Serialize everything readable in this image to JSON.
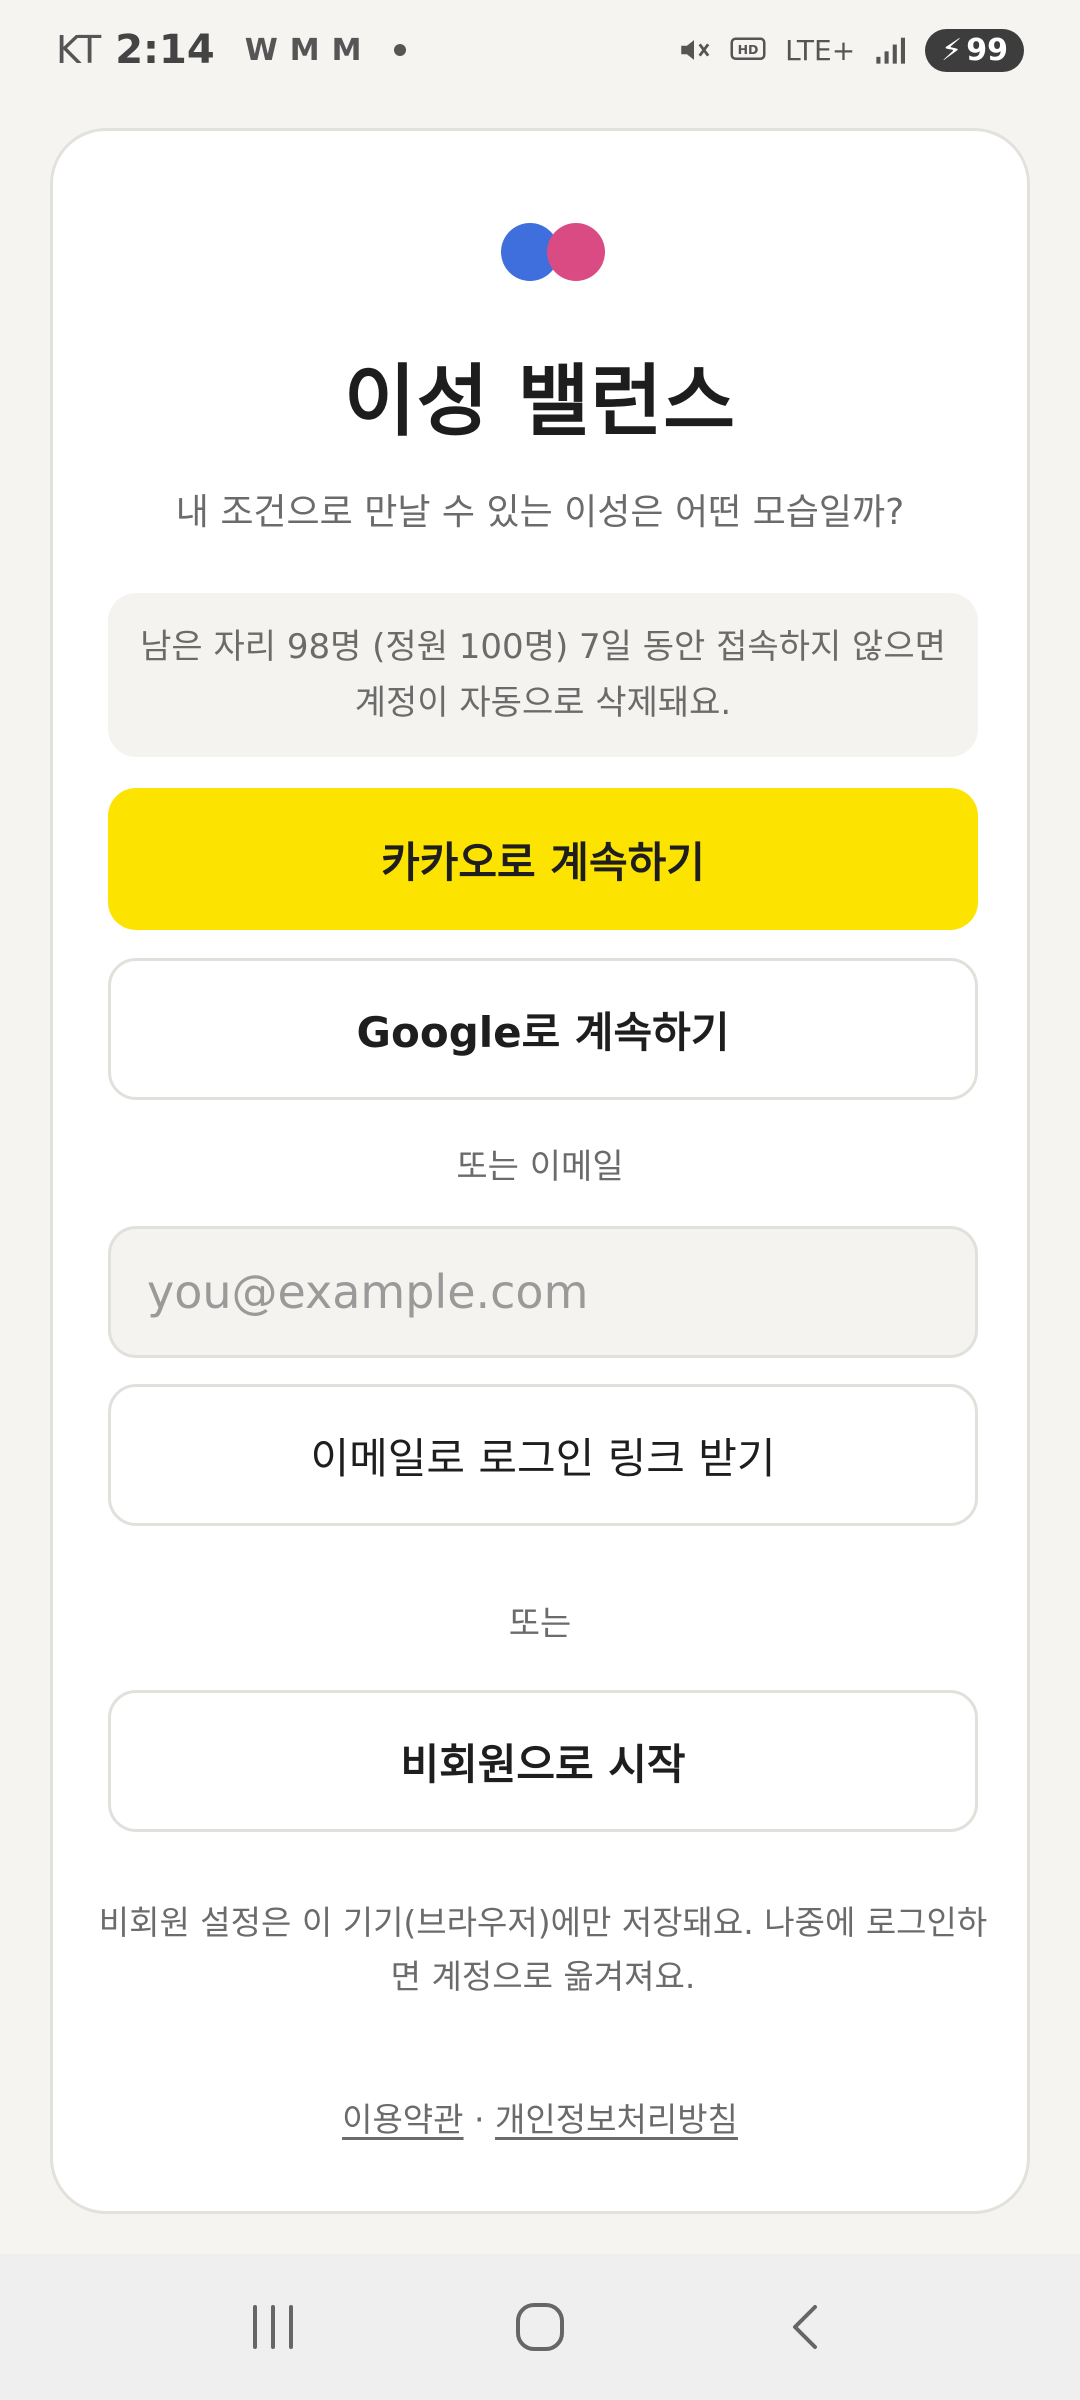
{
  "status_bar": {
    "carrier": "KT",
    "time": "2:14",
    "notification_icons": [
      "W",
      "M",
      "M"
    ],
    "battery": "99",
    "network": "LTE+"
  },
  "app": {
    "title": "이성 밸런스",
    "subtitle": "내 조건으로 만날 수 있는 이성은 어떤 모습일까?",
    "notice": "남은 자리 98명 (정원 100명) 7일 동안 접속하지 않으면 계정이 자동으로 삭제돼요.",
    "kakao_button": "카카오로 계속하기",
    "google_button": "Google로 계속하기",
    "or_email": "또는 이메일",
    "email_placeholder": "you@example.com",
    "email_link_button": "이메일로 로그인 링크 받기",
    "or": "또는",
    "guest_button": "비회원으로 시작",
    "guest_note": "비회원 설정은 이 기기(브라우저)에만 저장돼요. 나중에 로그인하면 계정으로 옮겨져요.",
    "terms_link": "이용약관",
    "separator": "·",
    "privacy_link": "개인정보처리방침"
  },
  "colors": {
    "kakao_yellow": "#fce300",
    "logo_blue": "#3f6fdc",
    "logo_pink": "#d94b82"
  }
}
